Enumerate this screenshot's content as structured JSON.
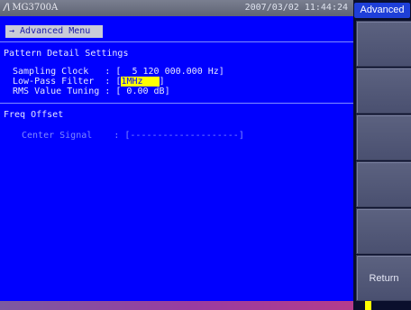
{
  "header": {
    "brand": "MG3700A",
    "datetime": "2007/03/02  11:44:24"
  },
  "breadcrumb": "→ Advanced Menu",
  "pattern_section": {
    "title": "Pattern Detail Settings",
    "sampling_clock": {
      "label": "Sampling Clock   : ",
      "value": "[  5 120 000.000 Hz]"
    },
    "low_pass_filter": {
      "label": "Low-Pass Filter  : ",
      "open": "[",
      "value": "1MHz   ",
      "close": "]"
    },
    "rms_tuning": {
      "label": "RMS Value Tuning : ",
      "value": "[ 0.00 dB]"
    }
  },
  "freq_section": {
    "title": "Freq Offset",
    "center_signal": {
      "label": "Center Signal    : ",
      "value": "[--------------------]"
    }
  },
  "softkeys": {
    "tab_label": "Advanced",
    "keys": [
      "",
      "",
      "",
      "",
      "",
      "Return"
    ]
  },
  "colors": {
    "screen_bg": "#0000ff",
    "highlight": "#ffff00"
  }
}
